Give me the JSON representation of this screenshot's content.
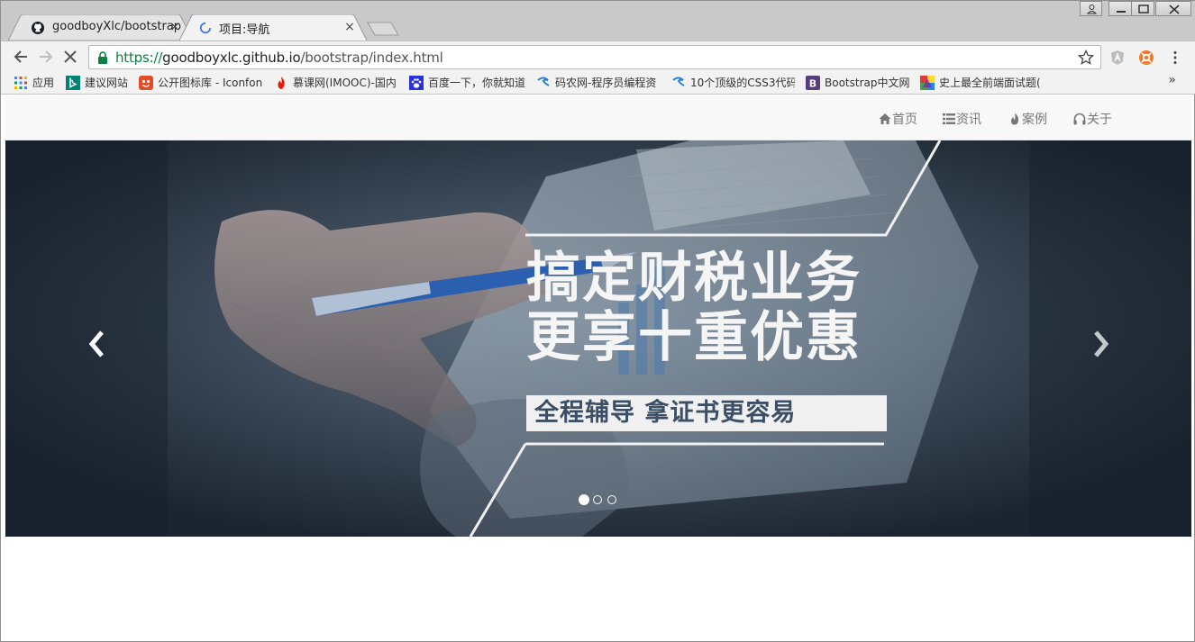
{
  "browser": {
    "tabs": [
      {
        "title": "goodboyXlc/bootstrap",
        "close": "×"
      },
      {
        "title": "项目:导航",
        "close": "×"
      }
    ],
    "address": {
      "scheme": "https://",
      "host": "goodboyxlc.github.io",
      "path": "/bootstrap/index.html"
    },
    "bookmarks": [
      {
        "label": "应用",
        "icon": "apps-grid-icon"
      },
      {
        "label": "建议网站",
        "icon": "bing-icon"
      },
      {
        "label": "公开图标库 - Iconfon",
        "icon": "iconfont-icon"
      },
      {
        "label": "慕课网(IMOOC)-国内",
        "icon": "flame-icon"
      },
      {
        "label": "百度一下，你就知道",
        "icon": "baidu-paw-icon"
      },
      {
        "label": "码农网-程序员编程资",
        "icon": "link-arrow-icon"
      },
      {
        "label": "10个顶级的CSS3代码",
        "icon": "link-arrow-icon"
      },
      {
        "label": "Bootstrap中文网",
        "icon": "bootstrap-b-icon"
      },
      {
        "label": "史上最全前端面试题(",
        "icon": "colorful-icon"
      }
    ],
    "overflow": "»"
  },
  "site": {
    "nav": [
      {
        "label": "首页",
        "icon": "home-icon"
      },
      {
        "label": "资讯",
        "icon": "list-icon"
      },
      {
        "label": "案例",
        "icon": "fire-icon"
      },
      {
        "label": "关于",
        "icon": "headphones-icon"
      }
    ],
    "carousel": {
      "headline_line1": "搞定财税业务",
      "headline_line2": "更享十重优惠",
      "tagline": "全程辅导 拿证书更容易",
      "slide_count": 3,
      "active_slide": 1
    }
  },
  "colors": {
    "link_green": "#0b8043",
    "nav_text": "#777777",
    "banner_bg": "#26313b",
    "tagline_text": "#3b4f66"
  }
}
